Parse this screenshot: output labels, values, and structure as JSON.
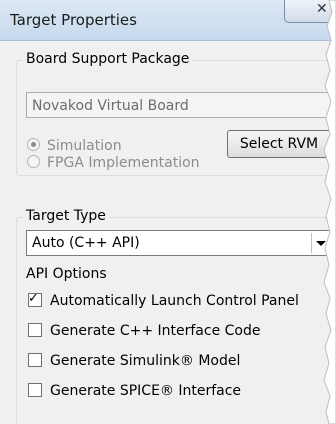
{
  "window": {
    "title": "Target Properties",
    "close_glyph": "✕"
  },
  "board_support": {
    "legend": "Board Support Package",
    "board_value": "Novakod Virtual Board",
    "mode_options": [
      {
        "label": "Simulation",
        "checked": true
      },
      {
        "label": "FPGA Implementation",
        "checked": false
      }
    ],
    "select_rvm_label": "Select RVM"
  },
  "target_type": {
    "legend": "Target Type",
    "selected_value": "Auto (C++ API)",
    "api_options_label": "API Options",
    "options": [
      {
        "label": "Automatically Launch Control Panel",
        "checked": true
      },
      {
        "label": "Generate C++ Interface Code",
        "checked": false
      },
      {
        "label": "Generate Simulink® Model",
        "checked": false
      },
      {
        "label": "Generate SPICE® Interface",
        "checked": false
      }
    ]
  },
  "icons": {
    "close": "close-icon",
    "dropdown": "chevron-down-icon",
    "check": "checkmark-icon"
  },
  "colors": {
    "titlebar": "#c7d9ee",
    "client": "#f0f0f0",
    "disabled_text": "#8c8c8c"
  }
}
